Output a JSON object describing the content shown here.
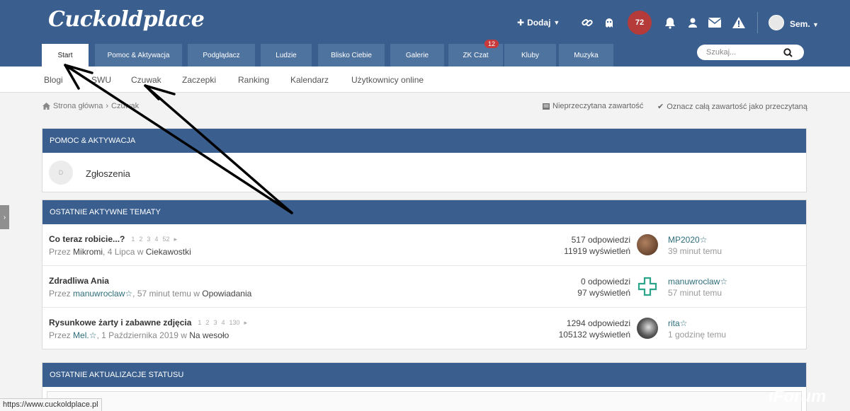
{
  "header": {
    "logo": "Cuckoldplace",
    "add_label": "Dodaj",
    "points": "72",
    "user_name": "Sem."
  },
  "tabs": [
    {
      "label": "Start",
      "active": true
    },
    {
      "label": "Pomoc & Aktywacja"
    },
    {
      "label": "Podglądacz"
    },
    {
      "label": "Ludzie"
    },
    {
      "label": "Blisko Ciebie"
    },
    {
      "label": "Galerie"
    },
    {
      "label": "ZK Czat",
      "badge": "12"
    },
    {
      "label": "Kluby"
    },
    {
      "label": "Muzyka"
    }
  ],
  "search": {
    "placeholder": "Szukaj..."
  },
  "subnav": [
    "Blogi",
    "SWU",
    "Czuwak",
    "Zaczepki",
    "Ranking",
    "Kalendarz",
    "Użytkownicy online"
  ],
  "breadcrumb": {
    "home": "Strona główna",
    "current": "Czuwak"
  },
  "breadcrumb_actions": {
    "unread": "Nieprzeczytana zawartość",
    "mark_read": "Oznacz całą zawartość jako przeczytaną"
  },
  "panels": {
    "help": {
      "title": "POMOC & AKTYWACJA",
      "forum_letter": "D",
      "forum_name": "Zgłoszenia"
    },
    "topics": {
      "title": "OSTATNIE AKTYWNE TEMATY",
      "rows": [
        {
          "title": "Co teraz robicie...?",
          "pages": [
            "1",
            "2",
            "3",
            "4",
            "52"
          ],
          "by": "Przez",
          "author": "Mikromi",
          "date": "4 Lipca",
          "in_word": "w",
          "forum": "Ciekawostki",
          "replies": "517 odpowiedzi",
          "views": "11919 wyświetleń",
          "last_user": "MP2020☆",
          "last_time": "39 minut temu"
        },
        {
          "title": "Zdradliwa Ania",
          "pages": [],
          "by": "Przez",
          "author": "manuwroclaw☆",
          "date": "57 minut temu",
          "in_word": "w",
          "forum": "Opowiadania",
          "replies": "0 odpowiedzi",
          "views": "97 wyświetleń",
          "last_user": "manuwroclaw☆",
          "last_time": "57 minut temu"
        },
        {
          "title": "Rysunkowe żarty i zabawne zdjęcia",
          "pages": [
            "1",
            "2",
            "3",
            "4",
            "130"
          ],
          "by": "Przez",
          "author": "Mel.☆",
          "date": "1 Października 2019",
          "in_word": "w",
          "forum": "Na wesoło",
          "replies": "1294 odpowiedzi",
          "views": "105132 wyświetleń",
          "last_user": "rita☆",
          "last_time": "1 godzinę temu"
        }
      ]
    },
    "status": {
      "title": "OSTATNIE AKTUALIZACJE STATUSU"
    }
  },
  "status_bar": {
    "url": "https://www.cuckoldplace.pl"
  },
  "watermark": "iForum",
  "colors": {
    "brand": "#3a5f8e",
    "tab": "#4f739f",
    "badge": "#c7393a",
    "link": "#2e6d7a"
  }
}
